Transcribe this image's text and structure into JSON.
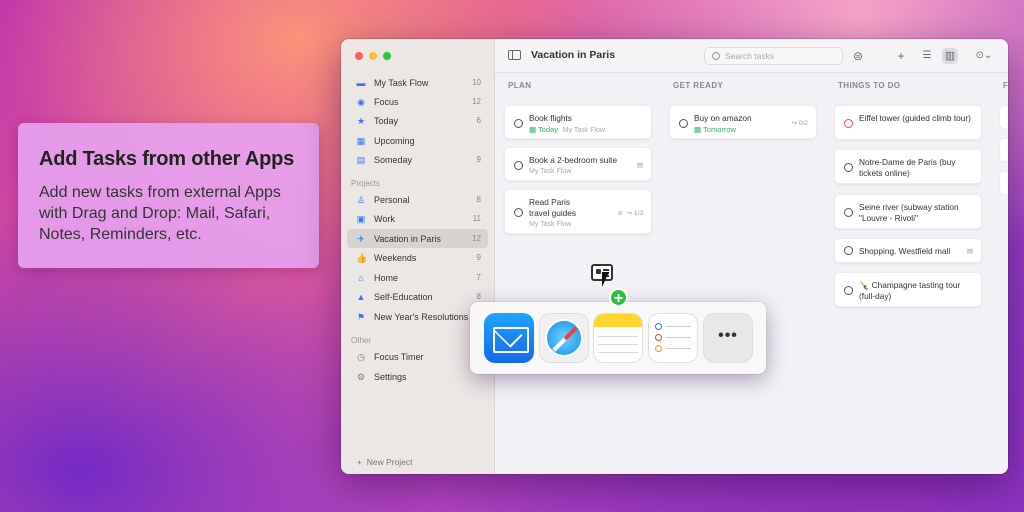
{
  "promo": {
    "title": "Add Tasks from other Apps",
    "text": "Add new tasks from external Apps with Drag and Drop: Mail, Safari, Notes, Reminders, etc."
  },
  "sidebar": {
    "items": [
      {
        "label": "My Task Flow",
        "count": "10",
        "icon": "tray-icon"
      },
      {
        "label": "Focus",
        "count": "12",
        "icon": "target-icon"
      },
      {
        "label": "Today",
        "count": "6",
        "icon": "star-icon"
      },
      {
        "label": "Upcoming",
        "count": "",
        "icon": "calendar-icon"
      },
      {
        "label": "Someday",
        "count": "9",
        "icon": "archive-icon"
      }
    ],
    "projects_header": "Projects",
    "projects": [
      {
        "label": "Personal",
        "count": "8",
        "icon": "person-icon"
      },
      {
        "label": "Work",
        "count": "11",
        "icon": "briefcase-icon"
      },
      {
        "label": "Vacation in Paris",
        "count": "12",
        "icon": "airplane-icon"
      },
      {
        "label": "Weekends",
        "count": "9",
        "icon": "thumbs-up-icon"
      },
      {
        "label": "Home",
        "count": "7",
        "icon": "house-icon"
      },
      {
        "label": "Self-Education",
        "count": "8",
        "icon": "graduation-cap-icon"
      },
      {
        "label": "New Year's Resolutions",
        "count": "",
        "icon": "flag-icon"
      }
    ],
    "other_header": "Other",
    "other": [
      {
        "label": "Focus Timer",
        "icon": "timer-icon"
      },
      {
        "label": "Settings",
        "icon": "gear-icon"
      }
    ],
    "new_project": "New Project"
  },
  "toolbar": {
    "title": "Vacation in Paris",
    "search_placeholder": "Search tasks"
  },
  "columns": [
    {
      "header": "PLAN",
      "cards": [
        {
          "title": "Book flights",
          "date": "Today",
          "sub": "My Task Flow"
        },
        {
          "title": "Book a 2-bedroom suite",
          "sub": "My Task Flow"
        },
        {
          "title": "Read Paris travel guides",
          "sub": "My Task Flow",
          "meta": "1/3"
        }
      ]
    },
    {
      "header": "GET READY",
      "cards": [
        {
          "title": "Buy on amazon",
          "date": "Tomorrow",
          "meta": "0/2"
        }
      ]
    },
    {
      "header": "THINGS TO DO",
      "cards": [
        {
          "title": "Eiffel tower (guided climb tour)"
        },
        {
          "title": "Notre-Dame de Paris (buy tickets online)"
        },
        {
          "title": "Seine river (subway station \"Louvre - Rivoli\""
        },
        {
          "title": "Shopping. Westfield mall"
        },
        {
          "title": "🍾 Champagne tasting tour (full-day)"
        }
      ]
    },
    {
      "header": "F"
    }
  ],
  "dock_apps": [
    "Mail",
    "Safari",
    "Notes",
    "Reminders",
    "More"
  ],
  "colors": {
    "accent": "#3478f6",
    "green": "#2fb457",
    "red": "#e3536b"
  }
}
